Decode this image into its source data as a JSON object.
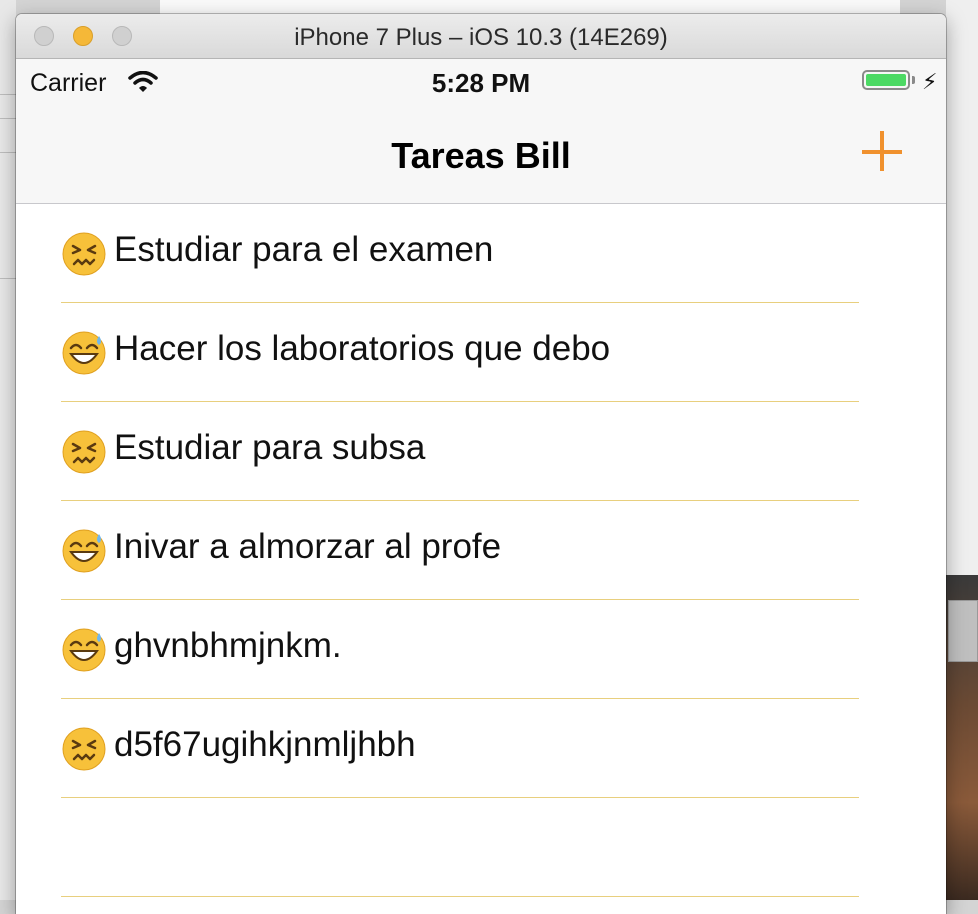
{
  "window": {
    "title": "iPhone 7 Plus – iOS 10.3 (14E269)"
  },
  "status_bar": {
    "carrier": "Carrier",
    "time": "5:28 PM",
    "battery_level": 1.0
  },
  "nav": {
    "title": "Tareas Bill",
    "add_icon": "plus-icon"
  },
  "tasks": [
    {
      "emoji": "confounded-face",
      "text": "Estudiar para el examen"
    },
    {
      "emoji": "grinning-sweat-face",
      "text": "Hacer los laboratorios que debo"
    },
    {
      "emoji": "confounded-face",
      "text": "Estudiar para subsa"
    },
    {
      "emoji": "grinning-sweat-face",
      "text": "Inivar a almorzar al profe"
    },
    {
      "emoji": "grinning-sweat-face",
      "text": "ghvnbhmjnkm."
    },
    {
      "emoji": "confounded-face",
      "text": "d5f67ugihkjnmljhbh"
    },
    {
      "emoji": "",
      "text": ""
    }
  ],
  "colors": {
    "accent": "#f0912e",
    "separator": "#e8cf7e",
    "battery": "#4cd964"
  }
}
